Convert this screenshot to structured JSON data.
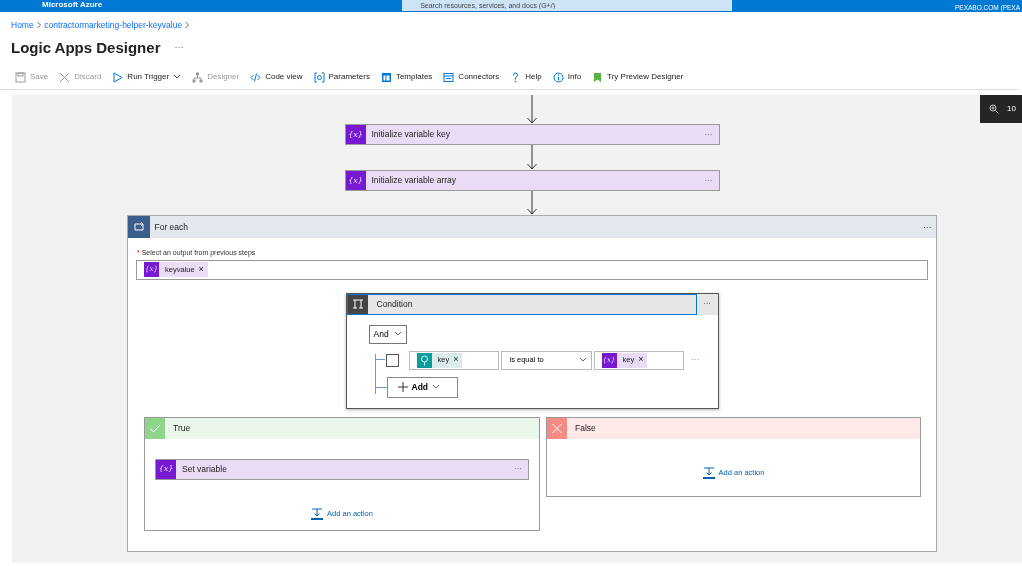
{
  "top_bar": {
    "brand": "Microsoft Azure",
    "search": {
      "placeholder": "Search resources, services, and docs (G+/)"
    },
    "account": "PEXABO.COM (PEXA"
  },
  "breadcrumb": [
    "Home",
    "contractormarketing-helper-keyvalue"
  ],
  "page_title": "Logic Apps Designer",
  "title_menu": "···",
  "toolbar": [
    {
      "label": "Save",
      "kind": "save",
      "disabled": true
    },
    {
      "label": "Discard",
      "kind": "discard",
      "disabled": true
    },
    {
      "label": "Run Trigger",
      "kind": "run",
      "disabled": false
    },
    {
      "label": "Designer",
      "kind": "designer",
      "disabled": true
    },
    {
      "label": "Code view",
      "kind": "code",
      "disabled": false
    },
    {
      "label": "Parameters",
      "kind": "parameters",
      "disabled": false
    },
    {
      "label": "Templates",
      "kind": "templates",
      "disabled": false
    },
    {
      "label": "Connectors",
      "kind": "connectors",
      "disabled": false
    },
    {
      "label": "Help",
      "kind": "help",
      "disabled": false
    },
    {
      "label": "Info",
      "kind": "info",
      "disabled": false
    },
    {
      "label": "Try Preview Designer",
      "kind": "preview",
      "disabled": false
    }
  ],
  "zoom": {
    "reading": "10"
  },
  "steps": [
    {
      "title": "Initialize variable key",
      "icon_text": "{x}",
      "menu": "···"
    },
    {
      "title": "Initialize variable array",
      "icon_text": "{x}",
      "menu": "···"
    }
  ],
  "for_each": {
    "title": "For each",
    "menu": "···",
    "field_label": "Select an output from previous steps",
    "required_mark": "*",
    "token": {
      "kind": "variable",
      "icon_text": "{x}",
      "label": "keyvalue",
      "remove": "×"
    },
    "condition": {
      "title": "Condition",
      "menu": "···",
      "group_operator": "And",
      "row": {
        "checked": false,
        "left": {
          "kind": "trigger",
          "label": "key",
          "remove": "×"
        },
        "operator": "is equal to",
        "right": {
          "kind": "variable",
          "icon_text": "{x}",
          "label": "key",
          "remove": "×"
        },
        "menu": "···"
      },
      "add_button": "Add"
    },
    "branches": [
      {
        "kind": "true",
        "title": "True",
        "actions": [
          {
            "title": "Set variable",
            "icon_text": "{x}",
            "menu": "···"
          }
        ],
        "add_action": "Add an action"
      },
      {
        "kind": "false",
        "title": "False",
        "add_action": "Add an action"
      }
    ]
  }
}
